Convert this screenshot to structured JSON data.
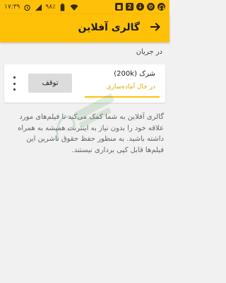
{
  "status_bar": {
    "time": "۱۷:۳۹",
    "battery": "۹۸٪",
    "notification_count": "2",
    "left_icons": [
      "alarm-icon",
      "mobile-data-icon",
      "wifi-icon",
      "battery-icon"
    ],
    "right_icons": [
      "headphones-icon",
      "settings-icon",
      "download-icon",
      "phone-icon",
      "sim-icon"
    ]
  },
  "app_bar": {
    "title": "گالری آفلاین",
    "back_icon": "arrow-right-icon"
  },
  "section": {
    "label": "در جریان"
  },
  "download_item": {
    "name": "شرک (200k)",
    "status": "در حال آماده‌سازی",
    "stop_label": "توقف",
    "menu_icon": "more-vert-icon",
    "progress_fraction": 1.0
  },
  "info": {
    "text": "گالری آفلاین به شما کمک می‌کند تا فیلم‌های مورد علاقه خود را بدون نیاز به اینترنت همیشه به همراه داشته باشید. به منظور حفظ حقوق ناشرین این فیلم‌ها قابل کپی برداری نیستند."
  },
  "colors": {
    "accent": "#ffc107",
    "status_text": "#e0a800",
    "background": "#f1f1f1"
  }
}
